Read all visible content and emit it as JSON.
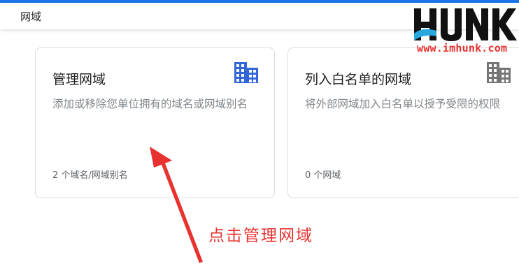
{
  "header": {
    "title": "网域"
  },
  "cards": [
    {
      "title": "管理网域",
      "description": "添加或移除您单位拥有的域名或网域别名",
      "count": "2 个域名/网域别名",
      "icon": "building-icon",
      "icon_color": "#3367d6"
    },
    {
      "title": "列入白名单的网域",
      "description": "将外部网域加入白名单以授予受限的权限",
      "count": "0 个网域",
      "icon": "building-icon",
      "icon_color": "#757575"
    }
  ],
  "logo": {
    "text": "HUNK",
    "url_text": "www.imhunk.com"
  },
  "annotation": {
    "text": "点击管理网域",
    "color": "#e8322f"
  }
}
